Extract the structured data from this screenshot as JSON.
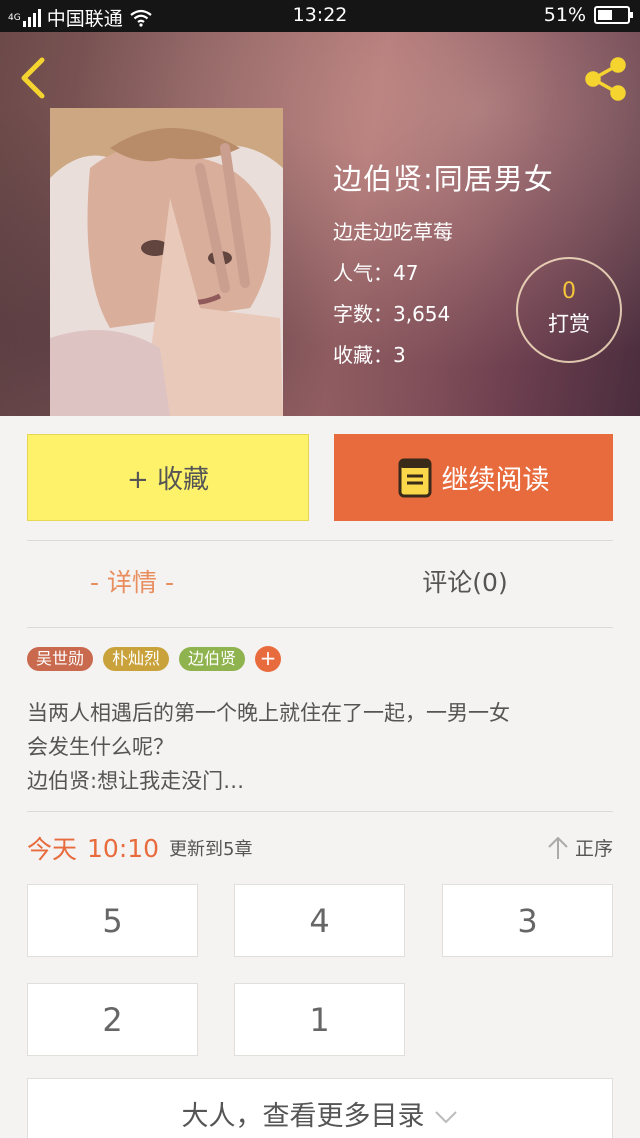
{
  "status_bar": {
    "network": "4G",
    "carrier": "中国联通",
    "time": "13:22",
    "battery": "51%",
    "battery_level": 0.51
  },
  "book": {
    "title": "边伯贤:同居男女",
    "author": "边走边吃草莓",
    "popularity_label": "人气：47",
    "word_count_label": "字数：3,654",
    "favorites_label": "收藏：3"
  },
  "reward": {
    "count": "0",
    "label": "打赏"
  },
  "actions": {
    "collect_label": "+ 收藏",
    "read_label": "继续阅读"
  },
  "tabs": {
    "detail": "-  详情  -",
    "comments": "评论(0)"
  },
  "tags": [
    {
      "label": "吴世勋",
      "color": "#c96a4e"
    },
    {
      "label": "朴灿烈",
      "color": "#c9a23c"
    },
    {
      "label": "边伯贤",
      "color": "#8fb34e"
    }
  ],
  "tag_add_label": "+",
  "description": {
    "line1": "当两人相遇后的第一个晚上就住在了一起，一男一女",
    "line2": "会发生什么呢？",
    "line3": "边伯贤:想让我走没门…"
  },
  "update": {
    "day": "今天",
    "time": "10:10",
    "text": "更新到5章"
  },
  "sort": {
    "label": "正序"
  },
  "chapters": [
    "5",
    "4",
    "3",
    "2",
    "1"
  ],
  "more_catalog": "大人，查看更多目录",
  "colors": {
    "accent": "#e86b3e",
    "collect": "#fdf26a",
    "reward_count": "#f5c53a"
  }
}
